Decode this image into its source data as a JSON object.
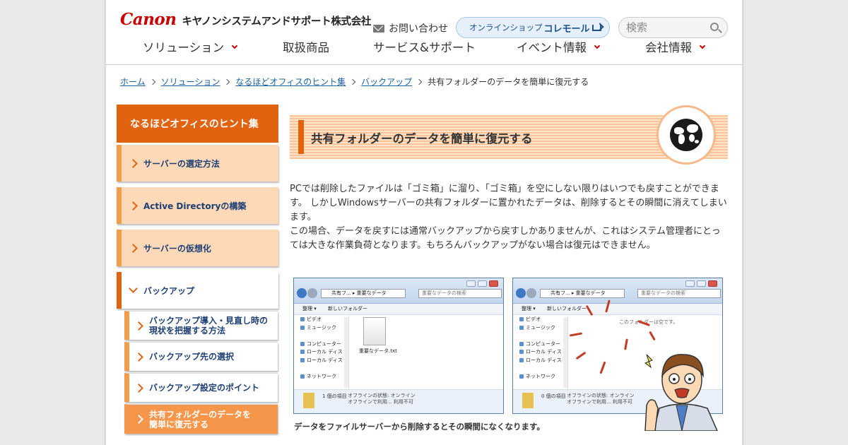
{
  "header": {
    "logo_brand": "Canon",
    "logo_company": "キヤノンシステムアンドサポート株式会社",
    "contact_label": "お問い合わせ",
    "shop_text": "オンラインショップ",
    "shop_brand": "コレモール",
    "search_placeholder": "検索"
  },
  "nav": [
    {
      "label": "ソリューション",
      "has_dropdown": true
    },
    {
      "label": "取扱商品",
      "has_dropdown": false
    },
    {
      "label": "サービス&サポート",
      "has_dropdown": false
    },
    {
      "label": "イベント情報",
      "has_dropdown": true
    },
    {
      "label": "会社情報",
      "has_dropdown": true
    }
  ],
  "breadcrumb": {
    "items": [
      "ホーム",
      "ソリューション",
      "なるほどオフィスのヒント集",
      "バックアップ"
    ],
    "current": "共有フォルダーのデータを簡単に復元する"
  },
  "sidebar": {
    "title": "なるほどオフィスのヒント集",
    "items": [
      "サーバーの選定方法",
      "Active Directoryの構築",
      "サーバーの仮想化",
      "バックアップ"
    ],
    "subitems": [
      [
        "バックアップ導入・見直し時の",
        "現状を把握する方法"
      ],
      [
        "バックアップ先の選択"
      ],
      [
        "バックアップ設定のポイント"
      ],
      [
        "共有フォルダーのデータを",
        "簡単に復元する"
      ]
    ]
  },
  "article": {
    "title": "共有フォルダーのデータを簡単に復元する",
    "body_lines": [
      "PCでは削除したファイルは「ゴミ箱」に溜り、「ゴミ箱」を空にしない限りはいつでも戻すことができま",
      "す。 しかしWindowsサーバーの共有フォルダーに置かれたデータは、削除するとその瞬間に消えてしまい",
      "ます。",
      "この場合、データを戻すには通常バックアップから戻すしかありませんが、これはシステム管理者にとっ",
      "ては大きな作業負荷となります。もちろんバックアップがない場合は復元はできません。"
    ],
    "caption": "データをファイルサーバーから削除するとその瞬間になくなります。"
  },
  "screenshots": {
    "path_a": "共有フ...",
    "path_b": "重要なデータ",
    "search": "重要なデータの検索",
    "toolbar": [
      "整理 ▾",
      "新しいフォルダー"
    ],
    "tree": [
      "ビデオ",
      "ミュージック",
      "",
      "コンピューター",
      "ローカル ディス",
      "ローカル ディス",
      "",
      "ネットワーク"
    ],
    "left_file": "重要なデータ.txt",
    "left_count": "1 個の項目",
    "right_count": "0 個の項目",
    "right_empty": "このフォルダーは空です。",
    "status_offline": "オフラインの状態: オンライン",
    "status_offline2": "オフラインで利用... 利用不可"
  }
}
